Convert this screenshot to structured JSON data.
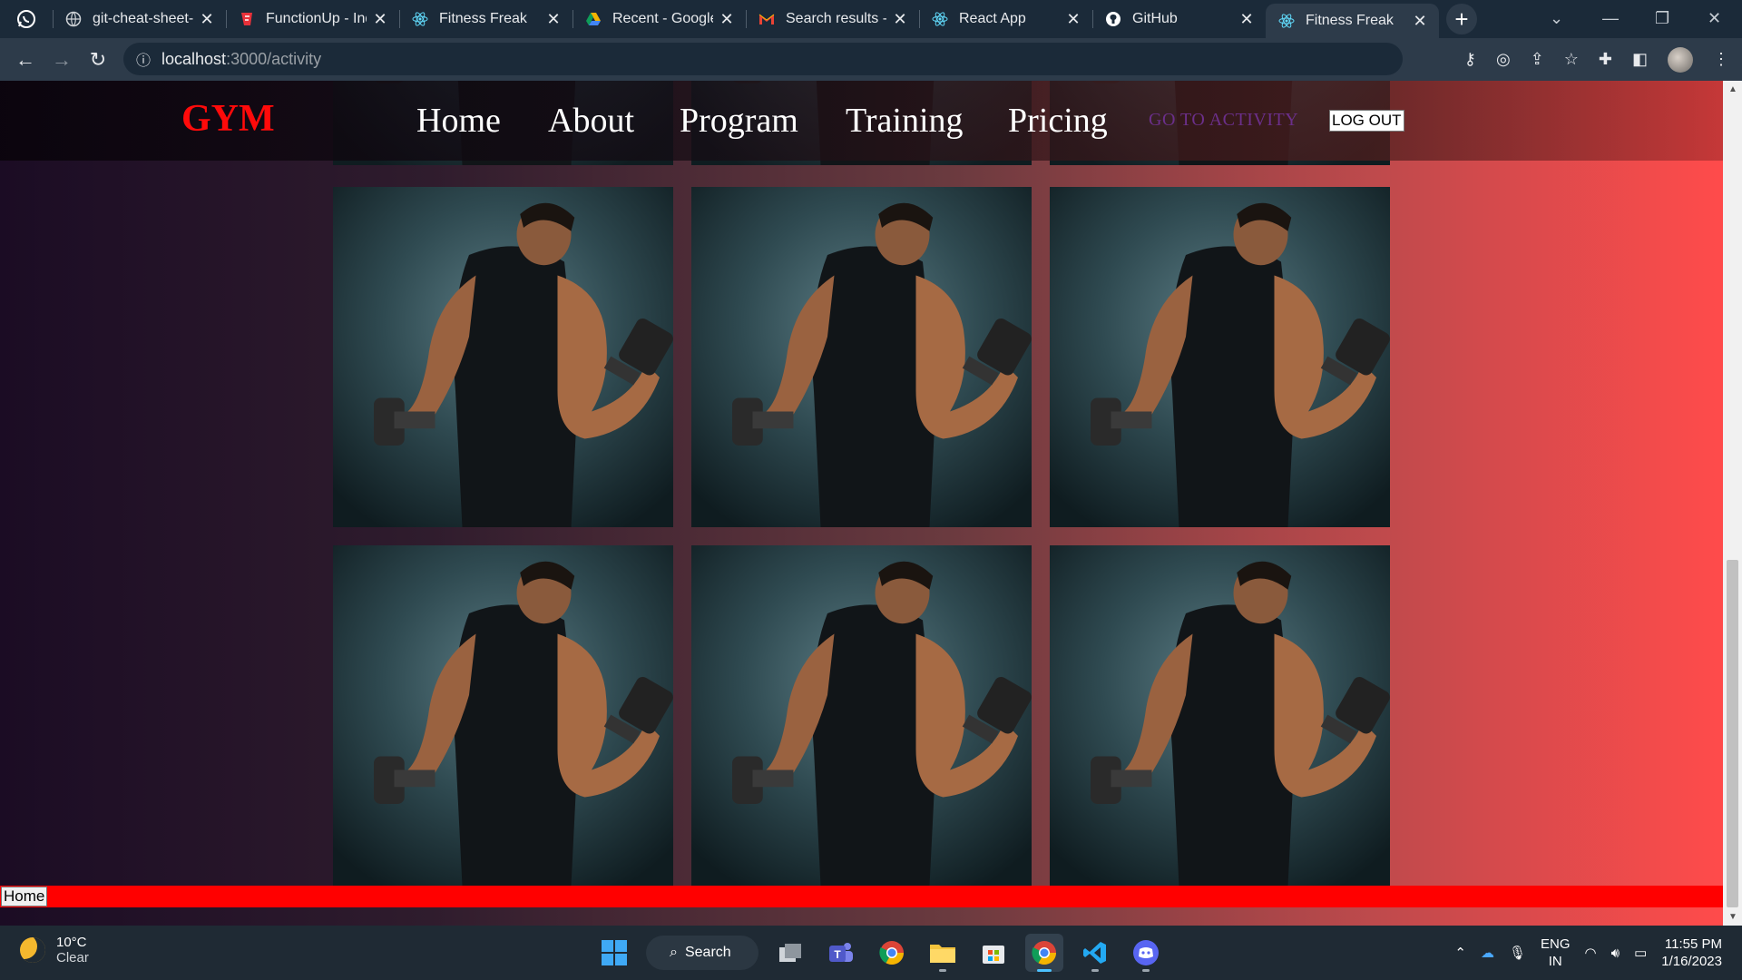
{
  "browser": {
    "tabs": [
      {
        "title": "git-cheat-sheet-",
        "icon": "globe-icon"
      },
      {
        "title": "FunctionUp - Ind",
        "icon": "functionup-icon"
      },
      {
        "title": "Fitness Freak",
        "icon": "react-icon"
      },
      {
        "title": "Recent - Google",
        "icon": "google-drive-icon"
      },
      {
        "title": "Search results - ",
        "icon": "gmail-icon"
      },
      {
        "title": "React App",
        "icon": "react-icon"
      },
      {
        "title": "GitHub",
        "icon": "github-icon"
      },
      {
        "title": "Fitness Freak",
        "icon": "react-icon",
        "active": true
      }
    ],
    "address": {
      "host": "localhost",
      "path": ":3000/activity"
    }
  },
  "page": {
    "brand": "GYM",
    "nav": [
      "Home",
      "About",
      "Program",
      "Training",
      "Pricing"
    ],
    "activity_link": "GO TO ACTIVITY",
    "logout_label": "LOG OUT",
    "footer_home_label": "Home",
    "gallery": {
      "image": "man lifting dumbbell",
      "count": 9
    }
  },
  "taskbar": {
    "weather": {
      "temp": "10°C",
      "condition": "Clear"
    },
    "search_label": "Search",
    "lang": {
      "line1": "ENG",
      "line2": "IN"
    },
    "time": "11:55 PM",
    "date": "1/16/2023"
  },
  "colors": {
    "brand": "#ff0a0a",
    "activity_link": "#6b2f8a",
    "footer": "#ff0000"
  }
}
